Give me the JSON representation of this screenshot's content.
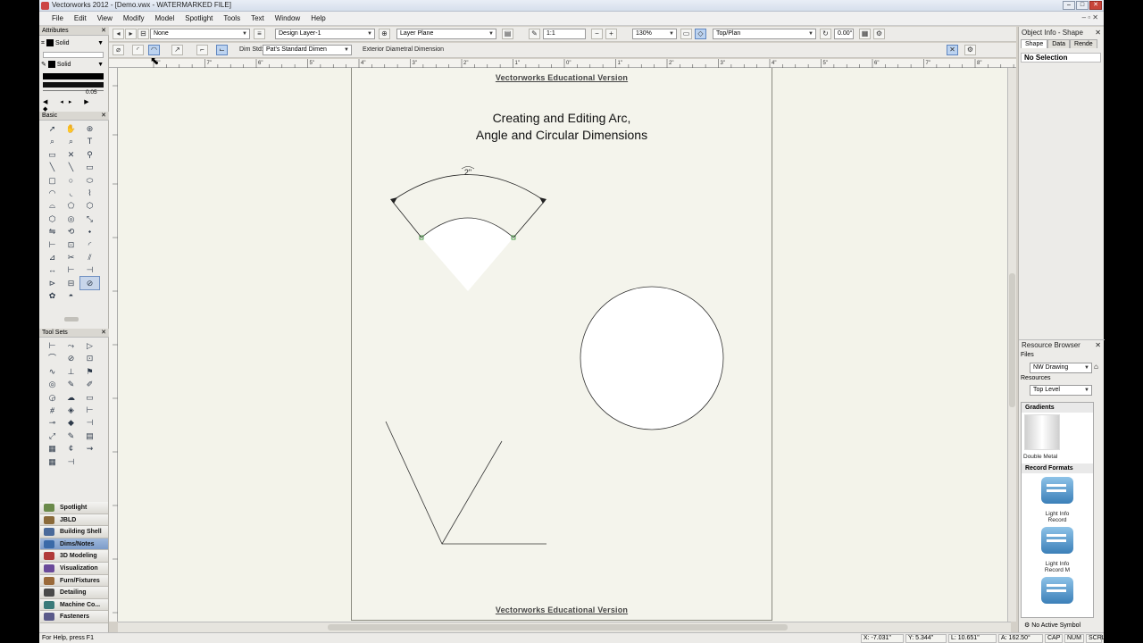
{
  "window": {
    "title": "Vectorworks 2012 - [Demo.vwx - WATERMARKED FILE]"
  },
  "menu": [
    "File",
    "Edit",
    "View",
    "Modify",
    "Model",
    "Spotlight",
    "Tools",
    "Text",
    "Window",
    "Help"
  ],
  "view_bar": {
    "class": "None",
    "layer": "Design Layer-1",
    "plane": "Layer Plane",
    "scale": "1:1",
    "zoom": "130%",
    "view": "Top/Plan",
    "rotation": "0.00°"
  },
  "mode_bar": {
    "dim_std_label": "Dim Std:",
    "dim_std_value": "Pat's Standard Dimen",
    "hint": "Exterior Diametral Dimension"
  },
  "attributes_palette": {
    "title": "Attributes",
    "fill_style": "Solid",
    "pen_style": "Solid",
    "line_weight": "0.05"
  },
  "basic_palette": {
    "title": "Basic"
  },
  "tool_sets_palette": {
    "title": "Tool Sets"
  },
  "tool_sets": [
    "Spotlight",
    "JBLD",
    "Building Shell",
    "Dims/Notes",
    "3D Modeling",
    "Visualization",
    "Furn/Fixtures",
    "Detailing",
    "Machine Co...",
    "Fasteners"
  ],
  "selected_tool_set": "Dims/Notes",
  "tool_set_colors": [
    "#6a8a4a",
    "#8a6a3a",
    "#4a6a9a",
    "#3a6aa8",
    "#b03a3a",
    "#6a4a9a",
    "#9a6a3a",
    "#4a4a4a",
    "#3a7a7a",
    "#5a5a8a"
  ],
  "drawing": {
    "watermark_top": "Vectorworks Educational Version",
    "watermark_bottom": "Vectorworks Educational Version",
    "title_line1": "Creating and Editing Arc,",
    "title_line2": "Angle and Circular Dimensions",
    "arc_dim_label": "2\""
  },
  "object_info": {
    "title": "Object Info - Shape",
    "tabs": [
      "Shape",
      "Data",
      "Rende"
    ],
    "selection": "No Selection"
  },
  "resource_browser": {
    "title": "Resource Browser",
    "files_label": "Files",
    "file_value": "NW Drawing",
    "resources_label": "Resources",
    "level_value": "Top Level",
    "sections": [
      {
        "name": "Gradients",
        "items": [
          "Double Metal"
        ]
      },
      {
        "name": "Record Formats",
        "items": [
          "Light Info Record",
          "Light Info Record M",
          ""
        ]
      }
    ],
    "footer": "No Active Symbol"
  },
  "status_bar": {
    "help": "For Help, press F1",
    "x": "X: -7.031\"",
    "y": "Y: 5.344\"",
    "l": "L: 10.651\"",
    "a": "A: 162.50°",
    "cap": "CAP",
    "num": "NUM",
    "scrl": "SCRL"
  },
  "ruler": {
    "top_labels": [
      "6\"",
      "7\"",
      "6\"",
      "5\"",
      "4\"",
      "3\"",
      "2\"",
      "1\"",
      "0\"",
      "1\"",
      "2\"",
      "3\"",
      "4\"",
      "5\"",
      "6\"",
      "7\"",
      "8\""
    ]
  }
}
